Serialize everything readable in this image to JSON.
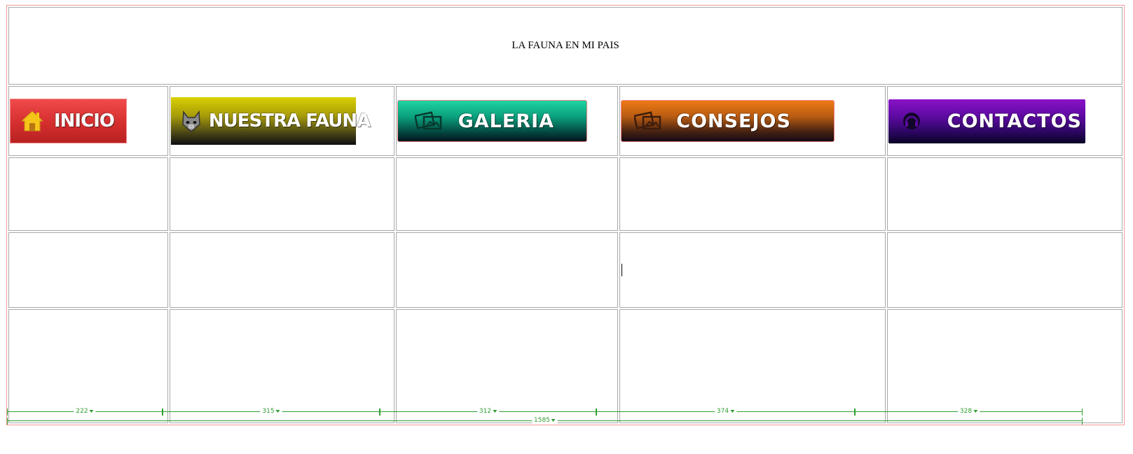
{
  "page": {
    "title": "LA FAUNA EN MI PAIS"
  },
  "nav": {
    "buttons": [
      {
        "label": "INICIO",
        "icon": "house-icon",
        "color": "#d52e2e"
      },
      {
        "label": "NUESTRA FAUNA",
        "icon": "cat-icon",
        "color": "#a59a0a"
      },
      {
        "label": "GALERIA",
        "icon": "photos-icon",
        "color": "#0a9f7c"
      },
      {
        "label": "CONSEJOS",
        "icon": "photos-icon",
        "color": "#b65a12"
      },
      {
        "label": "CONTACTOS",
        "icon": "headset-icon",
        "color": "#5c0aa0"
      }
    ]
  },
  "guides": {
    "columns": [
      "222",
      "315",
      "312",
      "374",
      "328"
    ],
    "total": "1585"
  },
  "colors": {
    "frame": "#f29a9a",
    "cell_border": "#a8a8a8",
    "guide": "#2f9e2f"
  }
}
